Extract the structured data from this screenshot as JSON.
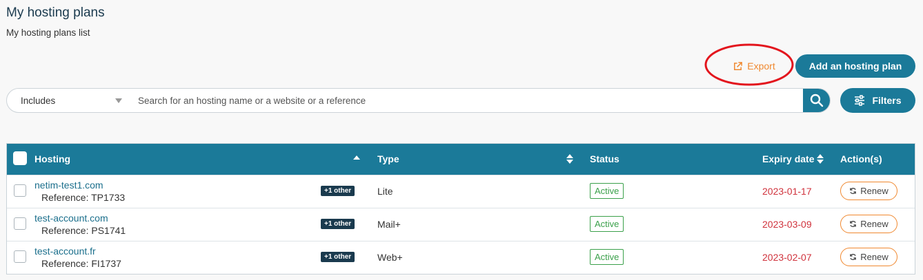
{
  "page": {
    "title": "My hosting plans",
    "subtitle": "My hosting plans list"
  },
  "toolbar": {
    "export_label": "Export",
    "add_label": "Add an hosting plan",
    "filters_label": "Filters"
  },
  "search": {
    "select_value": "Includes",
    "placeholder": "Search for an hosting name or a website or a reference"
  },
  "table": {
    "headers": {
      "hosting": "Hosting",
      "type": "Type",
      "status": "Status",
      "expiry": "Expiry date",
      "actions": "Action(s)"
    },
    "rows": [
      {
        "name": "netim-test1.com",
        "reference": "Reference: TP1733",
        "badge": "+1 other",
        "type": "Lite",
        "status": "Active",
        "expiry": "2023-01-17",
        "action": "Renew"
      },
      {
        "name": "test-account.com",
        "reference": "Reference: PS1741",
        "badge": "+1 other",
        "type": "Mail+",
        "status": "Active",
        "expiry": "2023-03-09",
        "action": "Renew"
      },
      {
        "name": "test-account.fr",
        "reference": "Reference: FI1737",
        "badge": "+1 other",
        "type": "Web+",
        "status": "Active",
        "expiry": "2023-02-07",
        "action": "Renew"
      }
    ]
  },
  "colors": {
    "primary": "#1b7a99",
    "accent_orange": "#f0882f",
    "status_green": "#3aa04a",
    "expiry_red": "#d0323c",
    "annotation_red": "#e3151d"
  }
}
